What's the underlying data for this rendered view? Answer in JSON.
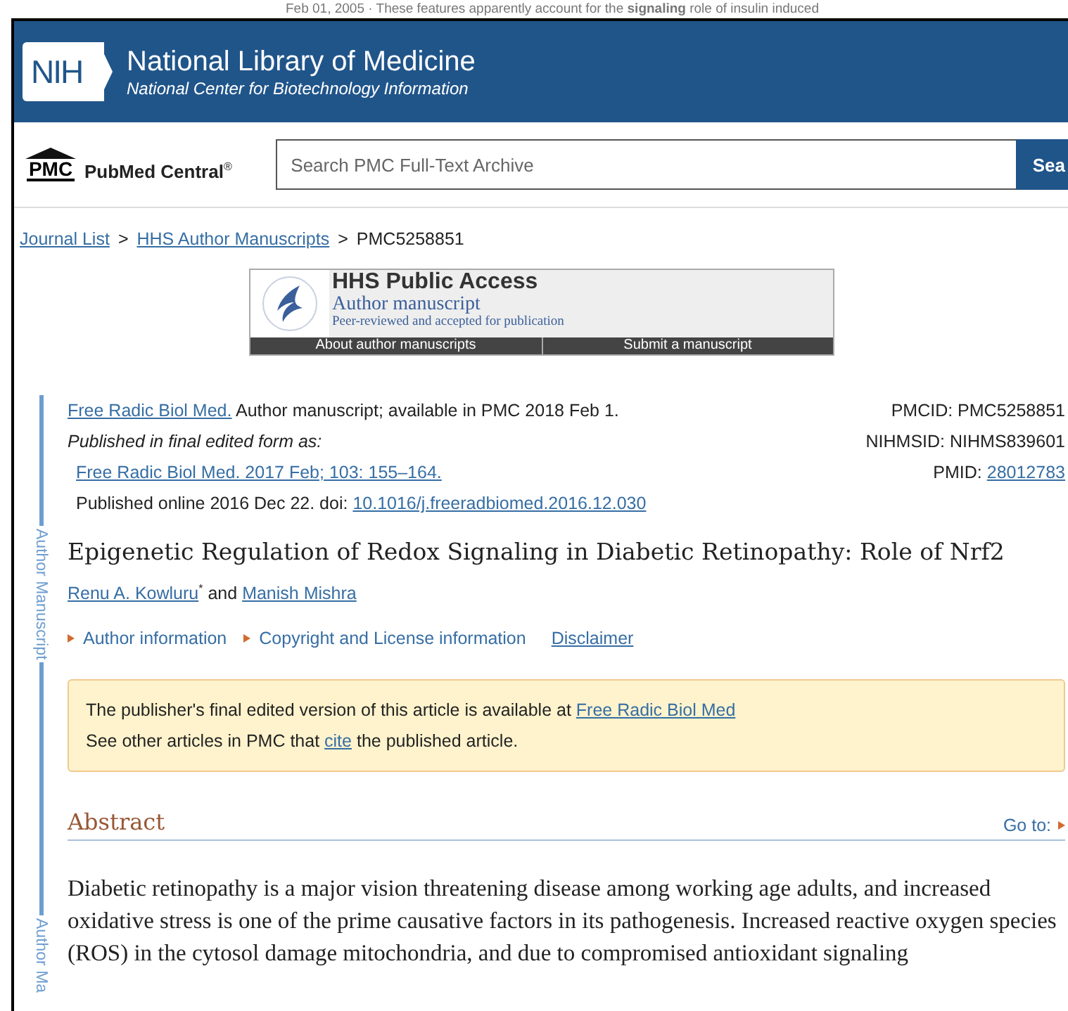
{
  "background_page": {
    "snippet": "Feb 01, 2005 · These features apparently account for the **signaling** role of insulin induced"
  },
  "header": {
    "logo": "NIH",
    "title": "National Library of Medicine",
    "subtitle": "National Center for Biotechnology Information"
  },
  "site": {
    "logo": "PMC",
    "name": "PubMed Central",
    "mark": "®"
  },
  "search": {
    "placeholder": "Search PMC Full-Text Archive",
    "button": "Sea"
  },
  "breadcrumb": [
    {
      "label": "Journal List",
      "link": true,
      "separator": ">"
    },
    {
      "label": "HHS Author Manuscripts",
      "link": true,
      "separator": ">"
    },
    {
      "label": "PMC5258851",
      "link": false
    }
  ],
  "banner": {
    "title": "HHS Public Access",
    "subtitle": "Author manuscript",
    "note": "Peer-reviewed and accepted for publication",
    "links": [
      "About author manuscripts",
      "Submit a manuscript"
    ]
  },
  "rail_labels": [
    "Author Manuscript",
    "Author Ma"
  ],
  "citation": {
    "journal": "Free Radic Biol Med.",
    "availability": "Author manuscript; available in PMC 2018 Feb 1.",
    "final_form_label": "Published in final edited form as:",
    "final_form": "Free Radic Biol Med. 2017 Feb; 103: 155–164.",
    "online": "Published online 2016 Dec 22. doi:",
    "doi": "10.1016/j.freeradbiomed.2016.12.030"
  },
  "ids": [
    {
      "label": "PMCID:",
      "value": "PMC5258851",
      "link": false
    },
    {
      "label": "NIHMSID:",
      "value": "NIHMS839601",
      "link": false
    },
    {
      "label": "PMID:",
      "value": "28012783",
      "link": true
    }
  ],
  "title": "Epigenetic Regulation of Redox Signaling in Diabetic Retinopathy: Role of Nrf2",
  "authors": [
    {
      "name": "Renu A. Kowluru",
      "mark": "*"
    },
    {
      "name": "Manish Mishra"
    }
  ],
  "author_joiner": "and",
  "info_links": [
    {
      "label": "Author information",
      "kind": "expander"
    },
    {
      "label": "Copyright and License information",
      "kind": "expander"
    },
    {
      "label": "Disclaimer",
      "kind": "link"
    }
  ],
  "notice": {
    "lines": [
      [
        {
          "text": "The publisher's final edited version of this article is available at",
          "link": false
        },
        {
          "text": "Free Radic Biol Med",
          "link": true
        }
      ],
      [
        {
          "text": "See other articles in PMC that",
          "link": false
        },
        {
          "text": "cite",
          "link": true
        },
        {
          "text": "the published article.",
          "link": false
        }
      ]
    ]
  },
  "abstract": {
    "heading": "Abstract",
    "goto": "Go to:",
    "text": "Diabetic retinopathy is a major vision threatening disease among working age adults, and increased oxidative stress is one of the prime causative factors in its pathogenesis. Increased reactive oxygen species (ROS) in the cytosol damage mitochondria, and due to compromised antioxidant signaling"
  }
}
